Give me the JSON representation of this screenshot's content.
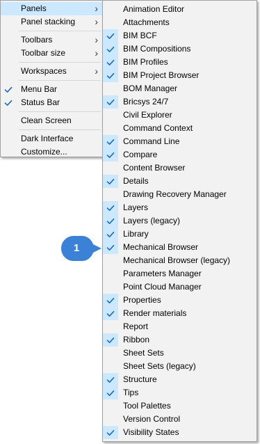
{
  "view_menu": {
    "items": [
      {
        "label": "Panels",
        "submenu": true,
        "checked": false,
        "highlighted": true
      },
      {
        "label": "Panel stacking",
        "submenu": true,
        "checked": false
      },
      {
        "separator": true
      },
      {
        "label": "Toolbars",
        "submenu": true,
        "checked": false
      },
      {
        "label": "Toolbar size",
        "submenu": true,
        "checked": false
      },
      {
        "separator": true
      },
      {
        "label": "Workspaces",
        "submenu": true,
        "checked": false
      },
      {
        "separator": true
      },
      {
        "label": "Menu Bar",
        "submenu": false,
        "checked": true
      },
      {
        "label": "Status Bar",
        "submenu": false,
        "checked": true
      },
      {
        "separator": true
      },
      {
        "label": "Clean Screen",
        "submenu": false,
        "checked": false
      },
      {
        "separator": true
      },
      {
        "label": "Dark Interface",
        "submenu": false,
        "checked": false
      },
      {
        "label": "Customize...",
        "submenu": false,
        "checked": false
      }
    ]
  },
  "panels_menu": {
    "items": [
      {
        "label": "Animation Editor",
        "checked": false
      },
      {
        "label": "Attachments",
        "checked": false
      },
      {
        "label": "BIM BCF",
        "checked": true
      },
      {
        "label": "BIM Compositions",
        "checked": true
      },
      {
        "label": "BIM Profiles",
        "checked": true
      },
      {
        "label": "BIM Project Browser",
        "checked": true
      },
      {
        "label": "BOM Manager",
        "checked": false
      },
      {
        "label": "Bricsys 24/7",
        "checked": true
      },
      {
        "label": "Civil Explorer",
        "checked": false
      },
      {
        "label": "Command Context",
        "checked": false
      },
      {
        "label": "Command Line",
        "checked": true
      },
      {
        "label": "Compare",
        "checked": true
      },
      {
        "label": "Content Browser",
        "checked": false
      },
      {
        "label": "Details",
        "checked": true
      },
      {
        "label": "Drawing Recovery Manager",
        "checked": false
      },
      {
        "label": "Layers",
        "checked": true
      },
      {
        "label": "Layers  (legacy)",
        "checked": true
      },
      {
        "label": "Library",
        "checked": true
      },
      {
        "label": "Mechanical Browser",
        "checked": true
      },
      {
        "label": "Mechanical Browser (legacy)",
        "checked": false
      },
      {
        "label": "Parameters Manager",
        "checked": false
      },
      {
        "label": "Point Cloud Manager",
        "checked": false
      },
      {
        "label": "Properties",
        "checked": true
      },
      {
        "label": "Render materials",
        "checked": true
      },
      {
        "label": "Report",
        "checked": false
      },
      {
        "label": "Ribbon",
        "checked": true
      },
      {
        "label": "Sheet Sets",
        "checked": false
      },
      {
        "label": "Sheet Sets (legacy)",
        "checked": false
      },
      {
        "label": "Structure",
        "checked": true
      },
      {
        "label": "Tips",
        "checked": true
      },
      {
        "label": "Tool Palettes",
        "checked": false
      },
      {
        "label": "Version Control",
        "checked": false
      },
      {
        "label": "Visibility States",
        "checked": true
      }
    ]
  },
  "callout": {
    "label": "1",
    "color": "#3b82d6"
  },
  "colors": {
    "highlight": "#cce8ff",
    "check": "#1f6fb8",
    "menu_bg": "#f2f2f2"
  }
}
